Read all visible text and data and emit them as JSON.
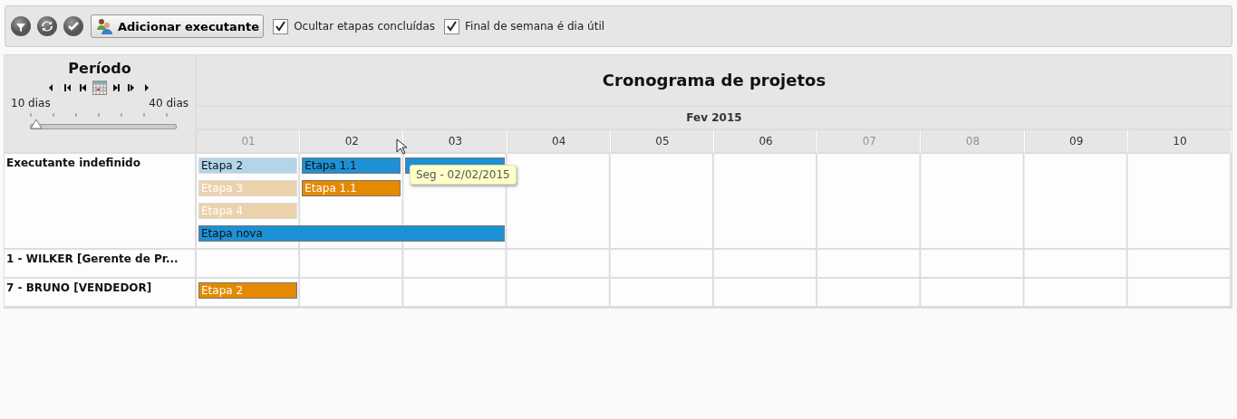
{
  "toolbar": {
    "icon_buttons": [
      {
        "kind": "filter"
      },
      {
        "kind": "refresh"
      },
      {
        "kind": "check"
      }
    ],
    "add_button": "Adicionar executante",
    "checkboxes": [
      {
        "label": "Ocultar etapas concluídas",
        "checked": true
      },
      {
        "label": "Final de semana é dia útil",
        "checked": true
      }
    ]
  },
  "period": {
    "title": "Período",
    "min_label": "10 dias",
    "max_label": "40 dias",
    "level": 0
  },
  "title": "Cronograma de projetos",
  "month": "Fev 2015",
  "days": [
    {
      "label": "01",
      "weekend": true
    },
    {
      "label": "02",
      "weekend": false
    },
    {
      "label": "03",
      "weekend": false
    },
    {
      "label": "04",
      "weekend": false
    },
    {
      "label": "05",
      "weekend": false
    },
    {
      "label": "06",
      "weekend": false
    },
    {
      "label": "07",
      "weekend": true
    },
    {
      "label": "08",
      "weekend": true
    },
    {
      "label": "09",
      "weekend": false
    },
    {
      "label": "10",
      "weekend": false
    }
  ],
  "rows": [
    {
      "name": "Executante indefinido",
      "tasks": [
        {
          "label": "Etapa 2",
          "kind": "normal",
          "faded": true
        },
        {
          "label": "Etapa 1.1",
          "kind": "normal",
          "faded": false
        },
        {
          "kind": "normal",
          "faded": false
        },
        {
          "label": "Etapa 3",
          "kind": "late",
          "faded": true
        },
        {
          "label": "Etapa 1.1",
          "kind": "late",
          "faded": false
        },
        {
          "label": "Etapa 4",
          "kind": "late",
          "faded": true
        },
        {
          "label": "Etapa nova",
          "kind": "normal",
          "faded": false
        }
      ]
    },
    {
      "name": "1 - WILKER [Gerente de Pr...",
      "tasks": []
    },
    {
      "name": "7 - BRUNO [VENDEDOR]",
      "tasks": [
        {
          "label": "Etapa 2",
          "kind": "late",
          "faded": false
        }
      ]
    }
  ],
  "tooltip": "Seg - 02/02/2015"
}
